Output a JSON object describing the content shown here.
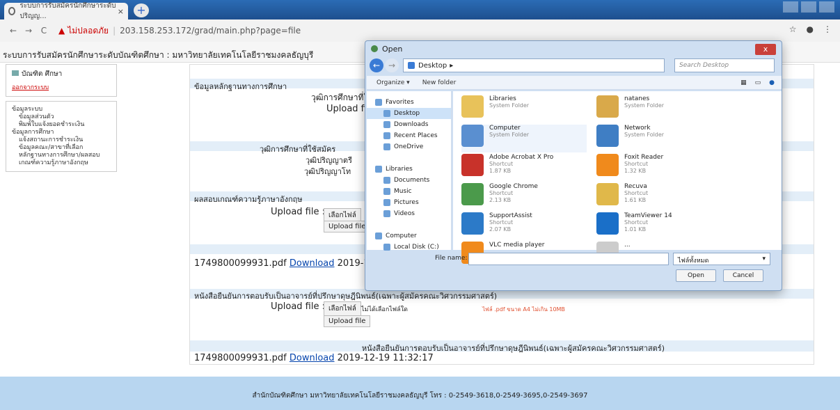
{
  "browser": {
    "tab_title": "ระบบการรับสมัครนักศึกษาระดับปริญญ...",
    "url": "203.158.253.172/grad/main.php?page=file",
    "security_text": "ไม่ปลอดภัย"
  },
  "page": {
    "header": "ระบบการรับสมัครนักศึกษาระดับบัณฑิตศึกษา : มหาวิทยาลัยเทคโนโลยีราชมงคลธัญบุรี",
    "user": "บัณฑิต ศึกษา",
    "logout": "ออกจากระบบ",
    "menu": [
      {
        "label": "ข้อมูลระบบ",
        "sub": false
      },
      {
        "label": "ข้อมูลส่วนตัว",
        "sub": true
      },
      {
        "label": "พิมพ์ใบแจ้งยอดชำระเงิน",
        "sub": true
      },
      {
        "label": "ข้อมูลการศึกษา",
        "sub": false
      },
      {
        "label": "แจ้งสถานะการชำระเงิน",
        "sub": true
      },
      {
        "label": "ข้อมูลคณะ/สาขาที่เลือก",
        "sub": true
      },
      {
        "label": "หลักฐานทางการศึกษา/ผลสอบ",
        "sub": true
      },
      {
        "label": "เกณฑ์ความรู้ภาษาอังกฤษ",
        "sub": true
      }
    ],
    "sec1_title": "ข้อมูลหลักฐานทางการศึกษา",
    "sec1_qual": "วุฒิการศึกษาที่ใช้สมัคร",
    "upload_label": "Upload file :",
    "qual_heading": "วุฒิการศึกษาที่ใช้สมัคร",
    "bachelor": "วุฒิปริญญาตรี",
    "master": "วุฒิปริญญาโท",
    "sec2_title": "ผลสอบเกณฑ์ความรู้ภาษาอังกฤษ",
    "choose_file": "เลือกไฟล์",
    "no_file": "ไม่ได้เลือกไฟล์ใด",
    "upload_btn": "Upload file",
    "pdf1_name": "1749800099931.pdf",
    "pdf1_date": "2019-1",
    "download": "Download",
    "sec3_title": "หนังสือยืนยันการตอบรับเป็นอาจารย์ที่ปรึกษาดุษฎีนิพนธ์(เฉพาะผู้สมัครคณะวิศวกรรมศาสตร์)",
    "hint": "ไฟล์ .pdf ขนาด A4 ไม่เกิน 10MB",
    "sec3_heading": "หนังสือยืนยันการตอบรับเป็นอาจารย์ที่ปรึกษาดุษฎีนิพนธ์(เฉพาะผู้สมัครคณะวิศวกรรมศาสตร์)",
    "pdf2_name": "1749800099931.pdf",
    "pdf2_date": "2019-12-19 11:32:17",
    "footer": "สำนักบัณฑิตศึกษา มหาวิทยาลัยเทคโนโลยีราชมงคลธัญบุรี โทร : 0-2549-3618,0-2549-3695,0-2549-3697"
  },
  "dialog": {
    "title": "Open",
    "path": "Desktop",
    "search_placeholder": "Search Desktop",
    "organize": "Organize ▾",
    "new_folder": "New folder",
    "nav": [
      {
        "label": "Favorites",
        "indent": false,
        "selected": false
      },
      {
        "label": "Desktop",
        "indent": true,
        "selected": true
      },
      {
        "label": "Downloads",
        "indent": true,
        "selected": false
      },
      {
        "label": "Recent Places",
        "indent": true,
        "selected": false
      },
      {
        "label": "OneDrive",
        "indent": true,
        "selected": false
      },
      {
        "label": "",
        "indent": false,
        "selected": false
      },
      {
        "label": "Libraries",
        "indent": false,
        "selected": false
      },
      {
        "label": "Documents",
        "indent": true,
        "selected": false
      },
      {
        "label": "Music",
        "indent": true,
        "selected": false
      },
      {
        "label": "Pictures",
        "indent": true,
        "selected": false
      },
      {
        "label": "Videos",
        "indent": true,
        "selected": false
      },
      {
        "label": "",
        "indent": false,
        "selected": false
      },
      {
        "label": "Computer",
        "indent": false,
        "selected": false
      },
      {
        "label": "Local Disk (C:)",
        "indent": true,
        "selected": false
      }
    ],
    "files": [
      {
        "name": "Libraries",
        "l2": "System Folder",
        "l3": "",
        "color": "#e8c25a"
      },
      {
        "name": "natanes",
        "l2": "System Folder",
        "l3": "",
        "color": "#d9a94a"
      },
      {
        "name": "Computer",
        "l2": "System Folder",
        "l3": "",
        "color": "#5a8fd0"
      },
      {
        "name": "Network",
        "l2": "System Folder",
        "l3": "",
        "color": "#3f7ec4"
      },
      {
        "name": "Adobe Acrobat X Pro",
        "l2": "Shortcut",
        "l3": "1.87 KB",
        "color": "#c8322a"
      },
      {
        "name": "Foxit Reader",
        "l2": "Shortcut",
        "l3": "1.32 KB",
        "color": "#f08a1c"
      },
      {
        "name": "Google Chrome",
        "l2": "Shortcut",
        "l3": "2.13 KB",
        "color": "#4b9a4b"
      },
      {
        "name": "Recuva",
        "l2": "Shortcut",
        "l3": "1.61 KB",
        "color": "#e0b84a"
      },
      {
        "name": "SupportAssist",
        "l2": "Shortcut",
        "l3": "2.07 KB",
        "color": "#2c7ac8"
      },
      {
        "name": "TeamViewer 14",
        "l2": "Shortcut",
        "l3": "1.01 KB",
        "color": "#1a6fc8"
      },
      {
        "name": "VLC media player",
        "l2": "",
        "l3": "",
        "color": "#f08a1c"
      },
      {
        "name": "...",
        "l2": "",
        "l3": "",
        "color": "#cccccc"
      }
    ],
    "file_name_label": "File name:",
    "file_type": "ไฟล์ทั้งหมด",
    "open": "Open",
    "cancel": "Cancel"
  }
}
